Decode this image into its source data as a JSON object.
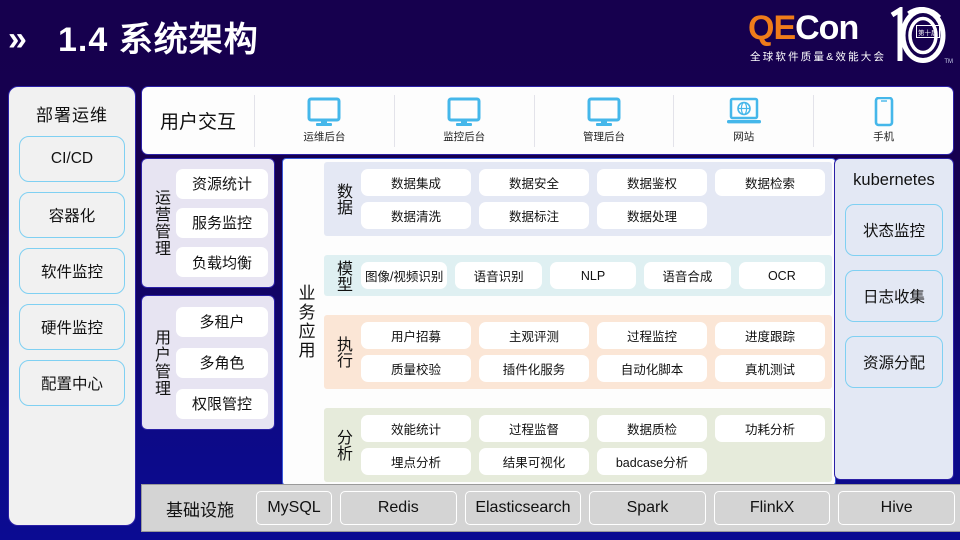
{
  "header": {
    "chevron_icon": "double-chevron-right",
    "title": "1.4 系统架构",
    "logo": {
      "qe": "QE",
      "con": "Con",
      "anniversary": "10",
      "badge": "第十届",
      "tm": "TM",
      "subtitle": "全球软件质量&效能大会"
    }
  },
  "left_column": {
    "title": "部署运维",
    "items": [
      "CI/CD",
      "容器化",
      "软件监控",
      "硬件监控",
      "配置中心"
    ]
  },
  "user_interaction": {
    "label": "用户交互",
    "channels": [
      {
        "icon": "monitor-icon",
        "label": "运维后台"
      },
      {
        "icon": "monitor-icon",
        "label": "监控后台"
      },
      {
        "icon": "monitor-icon",
        "label": "管理后台"
      },
      {
        "icon": "laptop-globe-icon",
        "label": "网站"
      },
      {
        "icon": "mobile-phone-icon",
        "label": "手机"
      }
    ]
  },
  "ops_column": {
    "groups": [
      {
        "label": "运营管理",
        "items": [
          "资源统计",
          "服务监控",
          "负载均衡"
        ]
      },
      {
        "label": "用户管理",
        "items": [
          "多租户",
          "多角色",
          "权限管控"
        ]
      }
    ]
  },
  "business": {
    "label": "业务应用",
    "rows": [
      {
        "label": "数据",
        "color": "#e4e8f4",
        "lines": [
          [
            "数据集成",
            "数据安全",
            "数据鉴权",
            "数据检索"
          ],
          [
            "数据清洗",
            "数据标注",
            "数据处理",
            ""
          ]
        ]
      },
      {
        "label": "模型",
        "color": "#dff0f2",
        "lines": [
          [
            "图像/视频识别",
            "语音识别",
            "NLP",
            "语音合成",
            "OCR"
          ]
        ]
      },
      {
        "label": "执行",
        "color": "#fbe6d6",
        "lines": [
          [
            "用户招募",
            "主观评测",
            "过程监控",
            "进度跟踪"
          ],
          [
            "质量校验",
            "插件化服务",
            "自动化脚本",
            "真机测试"
          ]
        ]
      },
      {
        "label": "分析",
        "color": "#e6ebdb",
        "lines": [
          [
            "效能统计",
            "过程监督",
            "数据质检",
            "功耗分析"
          ],
          [
            "埋点分析",
            "结果可视化",
            "badcase分析",
            ""
          ]
        ]
      }
    ]
  },
  "right_column": {
    "title": "kubernetes",
    "items": [
      "状态监控",
      "日志收集",
      "资源分配"
    ]
  },
  "infrastructure": {
    "label": "基础设施",
    "items": [
      "MySQL",
      "Redis",
      "Elasticsearch",
      "Spark",
      "FlinkX",
      "Hive"
    ]
  },
  "colors": {
    "background_top": "#16004e",
    "background_bottom": "#0b0b92",
    "accent_orange": "#ef7c1a",
    "icon_blue": "#45b7ea",
    "border_blue": "#2b20a6"
  }
}
